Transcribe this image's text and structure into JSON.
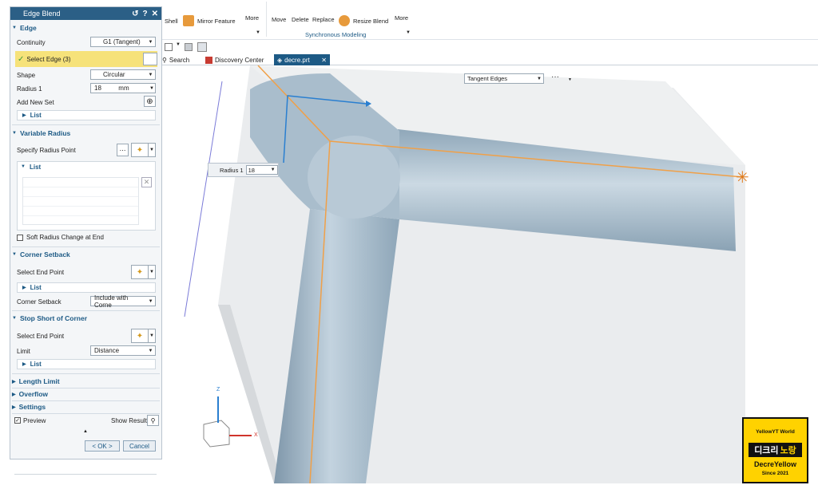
{
  "dialog": {
    "title": "Edge Blend",
    "edge": {
      "header": "Edge",
      "continuity_label": "Continuity",
      "continuity_value": "G1 (Tangent)",
      "select_edge": "Select Edge (3)",
      "shape_label": "Shape",
      "shape_value": "Circular",
      "radius_label": "Radius 1",
      "radius_value": "18",
      "radius_unit": "mm",
      "add_new_set": "Add New Set",
      "list": "List"
    },
    "variable_radius": {
      "header": "Variable Radius",
      "specify_point": "Specify Radius Point",
      "list": "List",
      "soft_radius": "Soft Radius Change at End"
    },
    "corner_setback": {
      "header": "Corner Setback",
      "select_end_point": "Select End Point",
      "list": "List",
      "setback_label": "Corner Setback",
      "setback_value": "Include with Corne"
    },
    "stop_short": {
      "header": "Stop Short of Corner",
      "select_end_point": "Select End Point",
      "limit_label": "Limit",
      "limit_value": "Distance",
      "list": "List"
    },
    "length_limit": "Length Limit",
    "overflow": "Overflow",
    "settings": "Settings",
    "preview": "Preview",
    "show_result": "Show Result",
    "ok": "< OK >",
    "cancel": "Cancel"
  },
  "ribbon": {
    "shell": "Shell",
    "mirror_feature": "Mirror Feature",
    "more1": "More",
    "move": "Move",
    "delete": "Delete",
    "replace": "Replace",
    "resize_blend": "Resize Blend",
    "more2": "More",
    "group_label": "Synchronous Modeling"
  },
  "tabs": {
    "search": "Search",
    "discovery": "Discovery Center",
    "file": "decre.prt"
  },
  "viewport": {
    "selection_filter": "Tangent Edges",
    "more_dots": "···",
    "radius_label": "Radius 1",
    "radius_value": "18",
    "axis_z": "Z",
    "axis_x": "X"
  },
  "watermark": {
    "line1": "YellowYT World",
    "korean": "디크리",
    "korean2": "노랑",
    "brand": "DecreYellow",
    "since": "Since 2021"
  },
  "colors": {
    "accent": "#1d5a85",
    "select_highlight": "#f6e27a",
    "edge_orange": "#f0a048",
    "blend_blue": "#a8bccc"
  }
}
